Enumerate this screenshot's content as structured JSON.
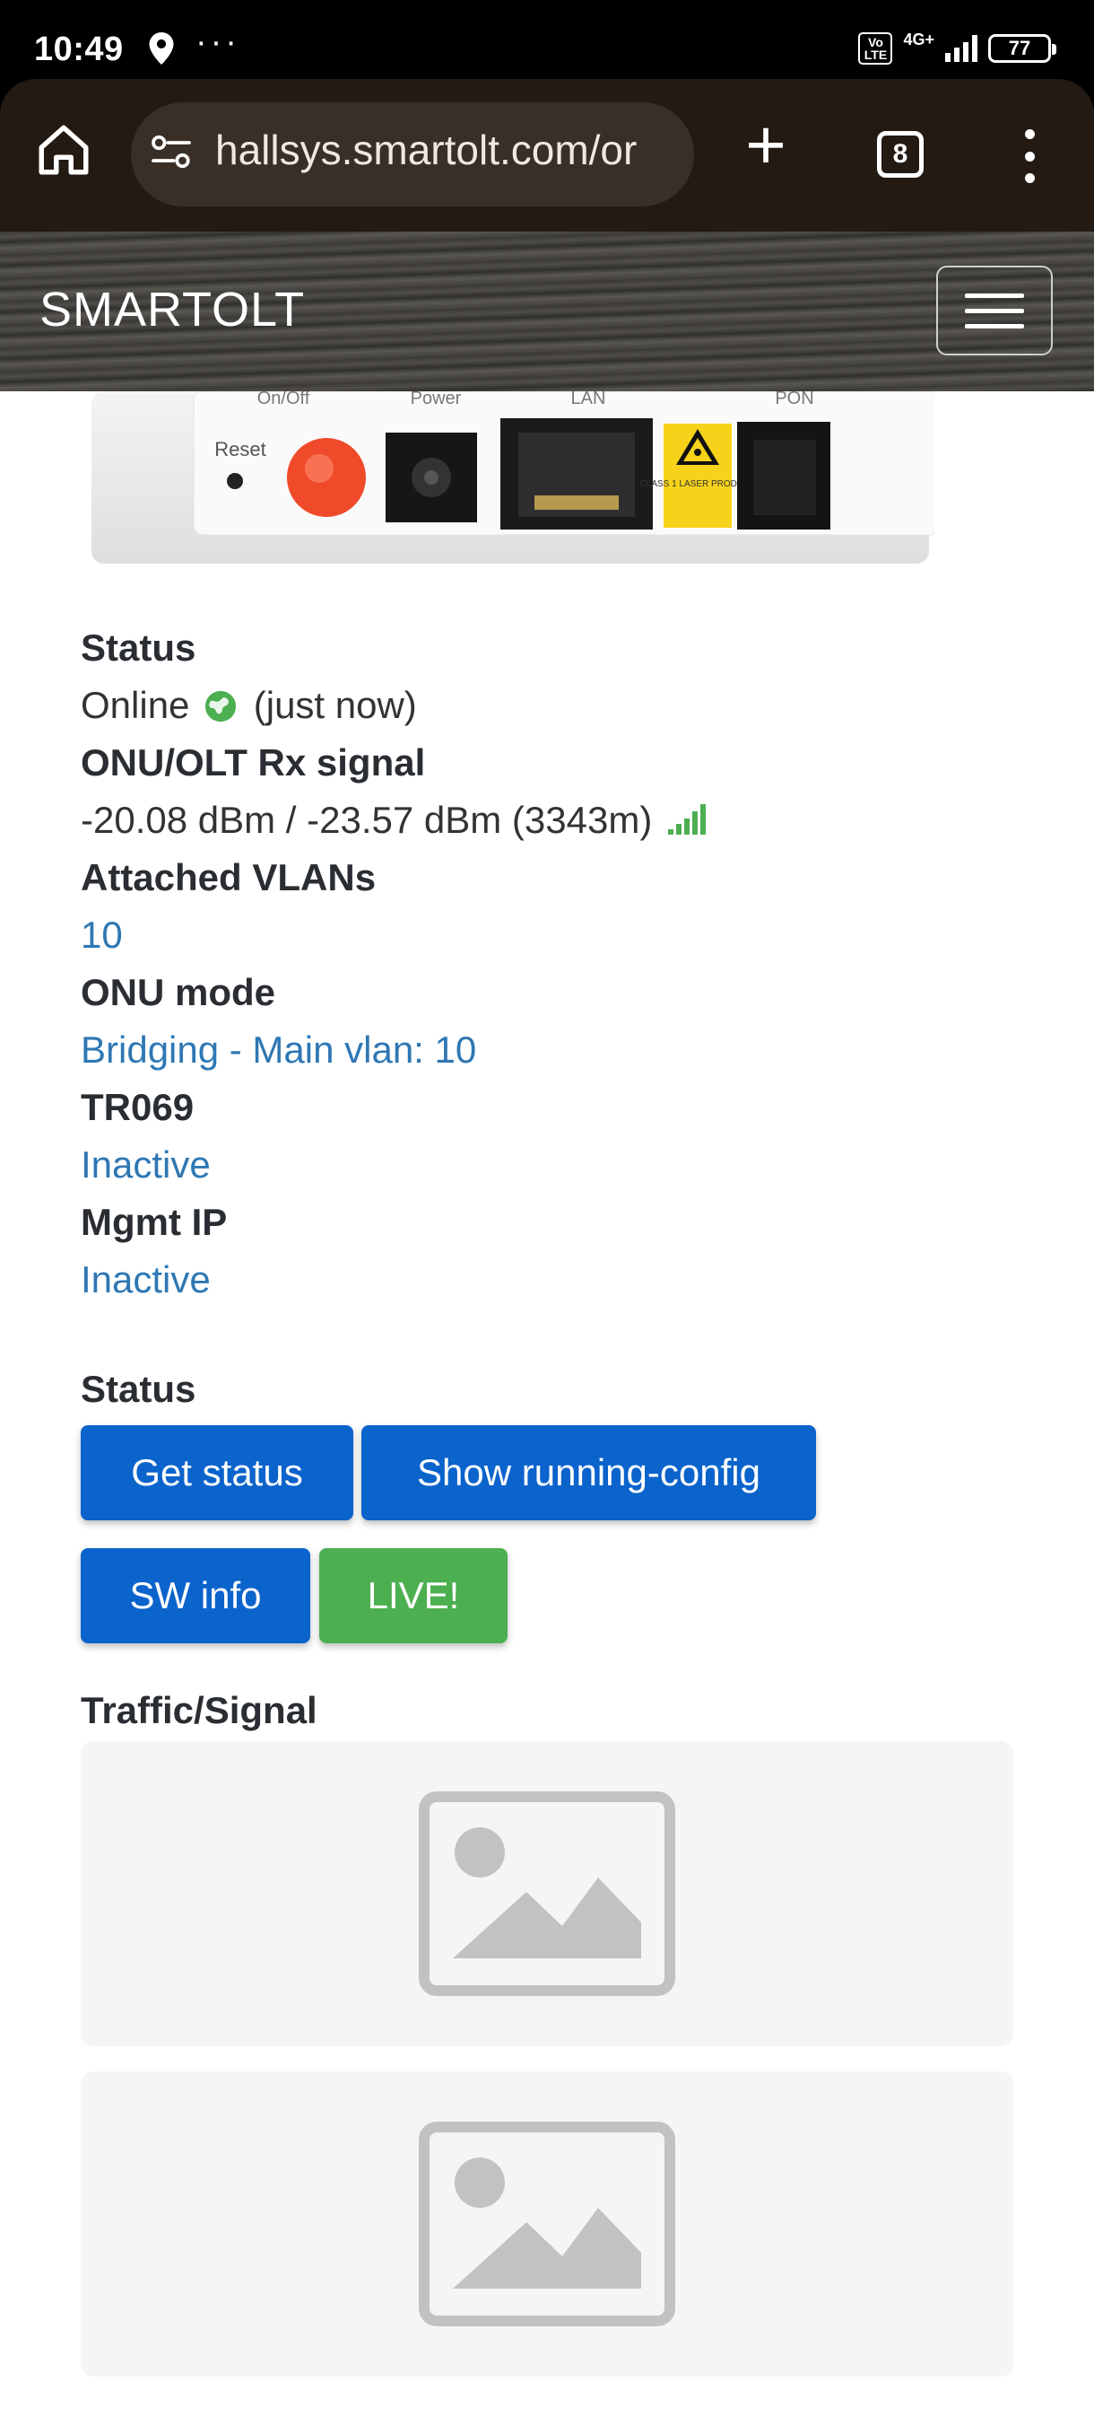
{
  "status_bar": {
    "time": "10:49",
    "dots": "···",
    "volte": "Vo LTE",
    "network": "4G+",
    "battery": "77"
  },
  "browser": {
    "url": "hallsys.smartolt.com/or",
    "tab_count": "8"
  },
  "site": {
    "brand": "SMARTOLT"
  },
  "device": {
    "labels": [
      "Reset",
      "On/Off",
      "Power",
      "LAN",
      "PON"
    ],
    "laser_label": "CLASS 1 LASER PRODUCT"
  },
  "info": {
    "status_label": "Status",
    "status_value": "Online",
    "status_time": "(just now)",
    "signal_label": "ONU/OLT Rx signal",
    "signal_value": "-20.08 dBm / -23.57 dBm (3343m)",
    "vlans_label": "Attached VLANs",
    "vlans_value": "10",
    "mode_label": "ONU mode",
    "mode_value": "Bridging - Main vlan: 10",
    "tr069_label": "TR069",
    "tr069_value": "Inactive",
    "mgmt_label": "Mgmt IP",
    "mgmt_value": "Inactive"
  },
  "actions": {
    "heading": "Status",
    "get_status": "Get status",
    "show_config": "Show running-config",
    "sw_info": "SW info",
    "live": "LIVE!"
  },
  "traffic": {
    "heading": "Traffic/Signal"
  },
  "colors": {
    "primary_button": "#0b63cc",
    "success_button": "#4caf50",
    "link": "#2e77b3",
    "online_green": "#4caf50"
  }
}
